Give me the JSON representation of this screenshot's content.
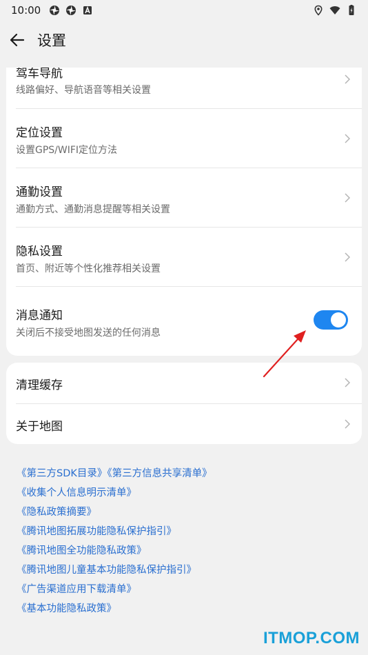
{
  "status_bar": {
    "time": "10:00",
    "left_icons": [
      "app-notification-icon",
      "app-notification-icon",
      "a-icon"
    ],
    "right_icons": [
      "location-icon",
      "wifi-icon",
      "battery-icon"
    ]
  },
  "header": {
    "back_icon": "arrow-left-icon",
    "title": "设置"
  },
  "settings_card": {
    "items": [
      {
        "title": "驾车导航",
        "subtitle": "线路偏好、导航语音等相关设置"
      },
      {
        "title": "定位设置",
        "subtitle": "设置GPS/WIFI定位方法"
      },
      {
        "title": "通勤设置",
        "subtitle": "通勤方式、通勤消息提醒等相关设置"
      },
      {
        "title": "隐私设置",
        "subtitle": "首页、附近等个性化推荐相关设置"
      }
    ],
    "notification": {
      "title": "消息通知",
      "subtitle": "关闭后不接受地图发送的任何消息",
      "enabled": true
    }
  },
  "misc_card": {
    "items": [
      {
        "title": "清理缓存"
      },
      {
        "title": "关于地图"
      }
    ]
  },
  "links": [
    "《第三方SDK目录》《第三方信息共享清单》",
    "《收集个人信息明示清单》",
    "《隐私政策摘要》",
    "《腾讯地图拓展功能隐私保护指引》",
    "《腾讯地图全功能隐私政策》",
    "《腾讯地图儿童基本功能隐私保护指引》",
    "《广告渠道应用下载清单》",
    "《基本功能隐私政策》"
  ],
  "watermark": "ITMOP.COM",
  "colors": {
    "accent": "#1e86f0",
    "link": "#2a6fd0",
    "annotation_arrow": "#e02020",
    "watermark": "#1aa0d8"
  }
}
